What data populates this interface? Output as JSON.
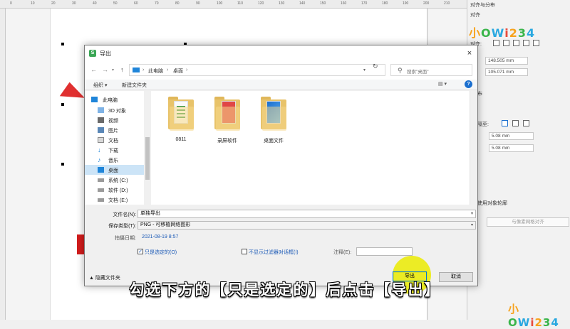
{
  "background_app": {
    "panel_title": "对齐与分布",
    "panel_section": "对齐",
    "align_to_label": "对齐:",
    "pos_x": "148.505 mm",
    "pos_y": "105.071 mm",
    "section_partial": "布",
    "spacing_label_partial": "隔至:",
    "width_partial": "5.08 mm",
    "height_partial": "5.08 mm",
    "use_object_outline_partial": "使用对象轮廓",
    "pixel_grid_button": "与像素网格对齐",
    "ruler_ticks": [
      "0",
      "10",
      "20",
      "30",
      "40",
      "50",
      "60",
      "70",
      "80",
      "90",
      "100",
      "110",
      "120",
      "130",
      "140",
      "150",
      "160",
      "170",
      "180",
      "190",
      "200",
      "210"
    ]
  },
  "watermark": {
    "chars": [
      "小",
      "O",
      "W",
      "i",
      "2",
      "3",
      "4"
    ]
  },
  "dialog": {
    "title": "导出",
    "close_glyph": "×",
    "address": {
      "computer": "此电脑",
      "desktop": "桌面"
    },
    "search_placeholder": "搜索\"桌面\"",
    "toolbar": {
      "organize": "组织 ▾",
      "new_folder": "新建文件夹"
    },
    "nav_items": [
      {
        "label": "此电脑",
        "icon": "computer-icon"
      },
      {
        "label": "3D 对象",
        "icon": "3d-objects-icon"
      },
      {
        "label": "视频",
        "icon": "video-icon"
      },
      {
        "label": "图片",
        "icon": "pictures-icon"
      },
      {
        "label": "文档",
        "icon": "documents-icon"
      },
      {
        "label": "下载",
        "icon": "download-icon"
      },
      {
        "label": "音乐",
        "icon": "music-icon"
      },
      {
        "label": "桌面",
        "icon": "desktop-icon",
        "selected": true
      },
      {
        "label": "系统 (C:)",
        "icon": "drive-icon"
      },
      {
        "label": "软件 (D:)",
        "icon": "drive-icon"
      },
      {
        "label": "文档 (E:)",
        "icon": "drive-icon"
      }
    ],
    "files": [
      {
        "name": "0811",
        "type": "folder"
      },
      {
        "name": "录屏软件",
        "type": "folder"
      },
      {
        "name": "桌面文件",
        "type": "folder"
      }
    ],
    "filename_label": "文件名(N):",
    "filename_value": "单独导出",
    "filetype_label": "保存类型(T):",
    "filetype_value": "PNG - 可移植网络图形",
    "date_label": "拍摄日期:",
    "date_value": "2021-08-19 8:57",
    "only_selected_label": "只是选定的(O)",
    "only_selected_checked": true,
    "no_filter_dialog_label": "不显示过滤器对话框(I)",
    "no_filter_dialog_checked": false,
    "note_label": "注释(E):",
    "note_value": "",
    "hide_folders": "隐藏文件夹",
    "export_button": "导出",
    "cancel_button": "取消"
  },
  "caption": "勾选下方的【只是选定的】后点击【导出】",
  "colors": {
    "accent_blue": "#1a59b6",
    "highlight_yellow": "#ecec14",
    "selection_blue": "#cce4f7"
  }
}
